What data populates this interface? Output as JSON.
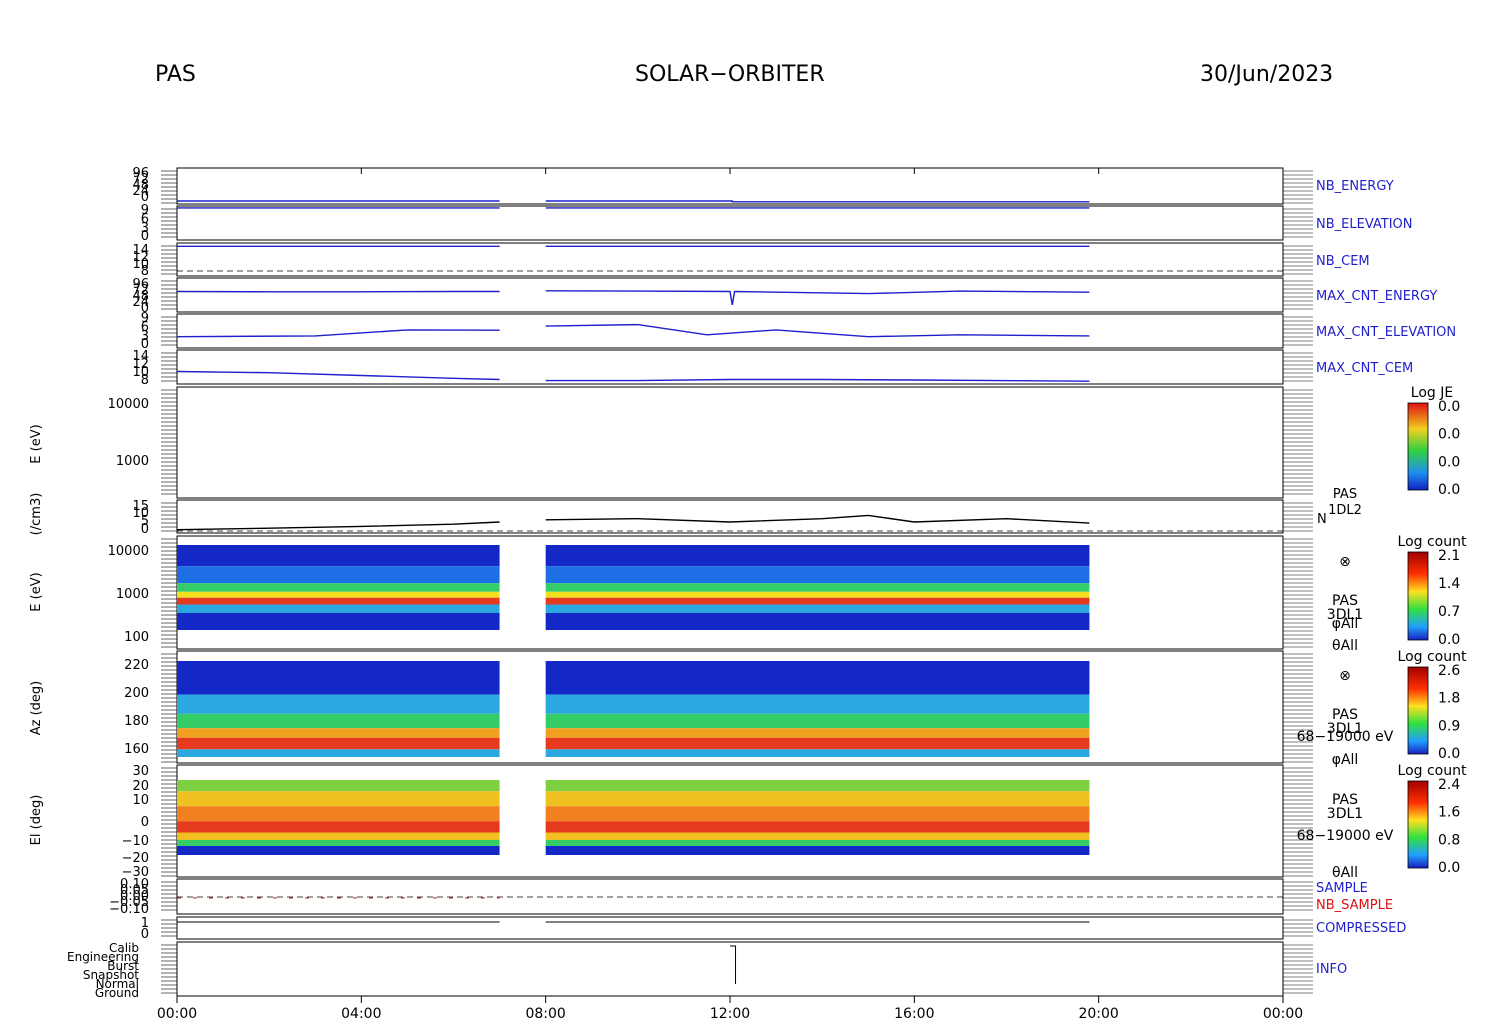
{
  "header": {
    "instrument": "PAS",
    "mission": "SOLAR−ORBITER",
    "date": "30/Jun/2023"
  },
  "chart_data": {
    "type": "line",
    "x_ticks": [
      "00:00",
      "04:00",
      "08:00",
      "12:00",
      "16:00",
      "20:00",
      "00:00"
    ],
    "x_range_hours": [
      0,
      24
    ],
    "data_gap_hours": [
      7.0,
      8.0
    ],
    "panels": [
      {
        "id": "nb_energy",
        "label": "NB_ENERGY",
        "color": "#1f1fcc",
        "ticks": [
          "96",
          "72",
          "48",
          "24",
          "0"
        ],
        "segments": [
          {
            "x": [
              0.0,
              6.0,
              6.0,
              7.0
            ],
            "y": [
              8,
              8,
              8,
              8
            ]
          },
          {
            "x": [
              8.0,
              12.05,
              12.05,
              19.8
            ],
            "y": [
              8,
              8,
              6,
              6
            ]
          }
        ]
      },
      {
        "id": "nb_elevation",
        "label": "NB_ELEVATION",
        "color": "#1f1fcc",
        "ticks": [
          "9",
          "6",
          "3",
          "0"
        ],
        "segments": [
          {
            "x": [
              0.0,
              7.0
            ],
            "y": [
              8.5,
              8.5
            ]
          },
          {
            "x": [
              8.0,
              19.8
            ],
            "y": [
              8.5,
              8.5
            ]
          }
        ]
      },
      {
        "id": "nb_cem",
        "label": "NB_CEM",
        "color": "#1f1fcc",
        "ticks": [
          "14",
          "12",
          "10",
          "8"
        ],
        "segments": [
          {
            "x": [
              0.0,
              7.0
            ],
            "y": [
              13.4,
              13.4
            ]
          },
          {
            "x": [
              8.0,
              19.8
            ],
            "y": [
              13.4,
              13.4
            ]
          }
        ]
      },
      {
        "id": "max_cnt_energy",
        "label": "MAX_CNT_ENERGY",
        "color": "#1f1fcc",
        "ticks": [
          "96",
          "72",
          "48",
          "24",
          "0"
        ],
        "segments": [
          {
            "x": [
              0.0,
              2.0,
              4.0,
              6.0,
              7.0
            ],
            "y": [
              58,
              57,
              57,
              58,
              58
            ]
          },
          {
            "x": [
              8.0,
              10.0,
              12.0,
              12.05,
              12.1,
              15.0,
              17.0,
              19.8
            ],
            "y": [
              60,
              59,
              58,
              20,
              58,
              52,
              59,
              56
            ]
          }
        ]
      },
      {
        "id": "max_cnt_elevation",
        "label": "MAX_CNT_ELEVATION",
        "color": "#1f1fcc",
        "ticks": [
          "9",
          "6",
          "3",
          "0"
        ],
        "segments": [
          {
            "x": [
              0.0,
              3.0,
              5.0,
              7.0
            ],
            "y": [
              3.0,
              3.2,
              4.8,
              4.7
            ]
          },
          {
            "x": [
              8.0,
              10.0,
              11.5,
              13.0,
              15.0,
              17.0,
              19.8
            ],
            "y": [
              5.8,
              6.2,
              3.5,
              4.8,
              3.0,
              3.5,
              3.2
            ]
          }
        ]
      },
      {
        "id": "max_cnt_cem",
        "label": "MAX_CNT_CEM",
        "color": "#1f1fcc",
        "ticks": [
          "14",
          "12",
          "10",
          "8"
        ],
        "segments": [
          {
            "x": [
              0.0,
              2.0,
              4.0,
              6.0,
              7.0
            ],
            "y": [
              10.2,
              10.0,
              9.5,
              9.0,
              8.8
            ]
          },
          {
            "x": [
              8.0,
              10.0,
              12.0,
              14.0,
              16.0,
              19.8
            ],
            "y": [
              8.6,
              8.6,
              8.8,
              8.8,
              8.7,
              8.5
            ]
          }
        ]
      },
      {
        "id": "je_energy",
        "ylabel": "E (eV)",
        "ticks": [
          "10000",
          "1000"
        ],
        "colorbar": {
          "title": "Log JE",
          "ticks": [
            "0.0",
            "0.0",
            "0.0",
            "0.0"
          ]
        }
      },
      {
        "id": "density",
        "ylabel": "(/cm3)",
        "ticks": [
          "15",
          "10",
          "5",
          "0"
        ],
        "labels": [
          "PAS",
          "1DL2",
          "N"
        ],
        "color": "#000000",
        "segments": [
          {
            "x": [
              0.0,
              2.0,
              4.0,
              6.0,
              7.0
            ],
            "y": [
              1.5,
              2.2,
              3.0,
              4.0,
              5.0
            ]
          },
          {
            "x": [
              8.0,
              10.0,
              12.0,
              14.0,
              15.0,
              16.0,
              18.0,
              19.8
            ],
            "y": [
              6.0,
              6.5,
              5.0,
              6.5,
              8.0,
              5.0,
              6.5,
              4.5
            ]
          }
        ]
      },
      {
        "id": "energy_spectrogram",
        "ylabel": "E (eV)",
        "ticks": [
          "10000",
          "1000",
          "100"
        ],
        "labels": [
          "⊗",
          "PAS",
          "3DL1",
          "φAll",
          "θAll"
        ],
        "colorbar": {
          "title": "Log count",
          "ticks": [
            "2.1",
            "1.4",
            "0.7",
            "0.0"
          ]
        }
      },
      {
        "id": "azimuth_spectrogram",
        "ylabel": "Az (deg)",
        "ticks": [
          "220",
          "200",
          "180",
          "160"
        ],
        "labels": [
          "⊗",
          "PAS",
          "3DL1",
          "68−19000 eV",
          "φAll"
        ],
        "colorbar": {
          "title": "Log count",
          "ticks": [
            "2.6",
            "1.8",
            "0.9",
            "0.0"
          ]
        }
      },
      {
        "id": "elevation_spectrogram",
        "ylabel": "El (deg)",
        "ticks": [
          "30",
          "20",
          "10",
          "0",
          "−10",
          "−20",
          "−30"
        ],
        "labels": [
          "PAS",
          "3DL1",
          "68−19000 eV",
          "θAll"
        ],
        "colorbar": {
          "title": "Log count",
          "ticks": [
            "2.4",
            "1.6",
            "0.8",
            "0.0"
          ]
        }
      },
      {
        "id": "sample",
        "ticks": [
          "0.10",
          "0.05",
          "0.00",
          "−0.05",
          "−0.10"
        ],
        "labels": [
          "SAMPLE",
          "NB_SAMPLE"
        ],
        "label_colors": [
          "#1f1fcc",
          "#e01010"
        ]
      },
      {
        "id": "compressed",
        "label": "COMPRESSED",
        "ticks": [
          "1",
          "0"
        ],
        "color": "#1f1fcc"
      },
      {
        "id": "info",
        "label": "INFO",
        "ticks": [
          "Calib",
          "Engineering",
          "Burst",
          "Snapshot",
          "Normal",
          "Ground"
        ],
        "color": "#1f1fcc"
      }
    ]
  }
}
